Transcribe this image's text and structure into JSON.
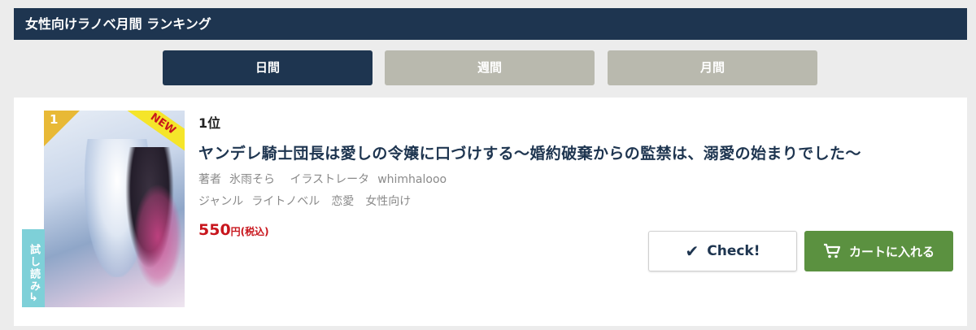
{
  "section": {
    "title": "女性向けラノベ月間 ランキング"
  },
  "tabs": [
    {
      "label": "日間",
      "active": true
    },
    {
      "label": "週間",
      "active": false
    },
    {
      "label": "月間",
      "active": false
    }
  ],
  "item": {
    "rank": "1位",
    "cover": {
      "rank_number": "1",
      "badge": "NEW",
      "trial_label": "試し読み",
      "trial_arrow": "↳"
    },
    "title": "ヤンデレ騎士団長は愛しの令嬢に口づけする〜婚約破棄からの監禁は、溺愛の始まりでした〜",
    "author_label": "著者",
    "author": "氷雨そら",
    "illustrator_label": "イラストレータ",
    "illustrator": "whimhalooo",
    "genre_label": "ジャンル",
    "genres": [
      "ライトノベル",
      "恋愛",
      "女性向け"
    ],
    "price": "550",
    "price_unit": "円(税込)",
    "check_label": "Check!",
    "check_icon": "checkmark-icon",
    "cart_label": "カートに入れる",
    "cart_icon": "cart-icon"
  },
  "colors": {
    "navy": "#1e3550",
    "tab_inactive": "#b9b9ae",
    "price_red": "#c8161d",
    "cart_green": "#5b9140",
    "rank_gold": "#e8b936",
    "trial_teal": "#7ed0d8"
  }
}
